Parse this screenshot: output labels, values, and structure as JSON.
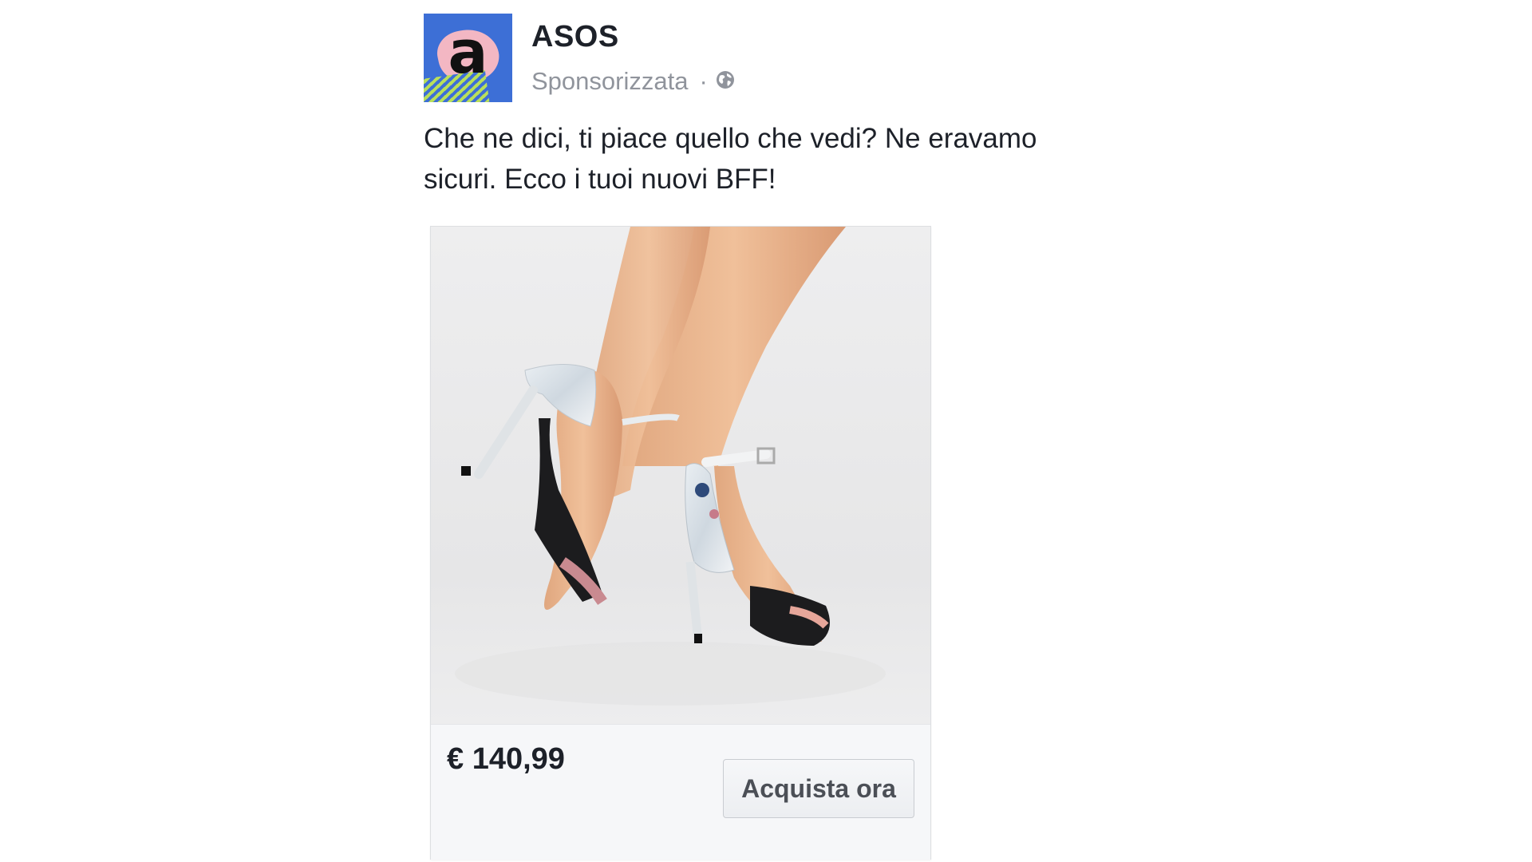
{
  "post": {
    "page_name": "ASOS",
    "avatar_letter": "a",
    "sponsored_label": "Sponsorizzata",
    "separator": "·",
    "audience_icon": "globe-icon",
    "message": "Che ne dici, ti piace quello che vedi? Ne eravamo sicuri. Ecco i tuoi nuovi BFF!"
  },
  "product": {
    "image_subject": "floral-print-heeled-sandals",
    "price": "€ 140,99",
    "cta_label": "Acquista ora"
  },
  "colors": {
    "avatar_background": "#3d6fd6",
    "avatar_accent": "#f3b7c3",
    "text_primary": "#1d2129",
    "text_secondary": "#90949c",
    "footer_background": "#f6f7f9"
  }
}
